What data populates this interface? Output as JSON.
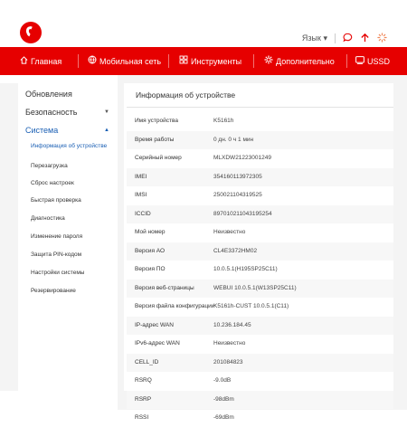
{
  "header": {
    "language_label": "Язык",
    "language_caret": "▾"
  },
  "nav": {
    "items": [
      {
        "label": "Главная",
        "icon": "home-icon"
      },
      {
        "label": "Мобильная сеть",
        "icon": "globe-icon"
      },
      {
        "label": "Инструменты",
        "icon": "tools-icon"
      },
      {
        "label": "Дополнительно",
        "icon": "gear-icon"
      },
      {
        "label": "USSD",
        "icon": "ussd-icon"
      }
    ]
  },
  "sidebar": {
    "sections": [
      {
        "label": "Обновления"
      },
      {
        "label": "Безопасность",
        "caret": "▼"
      },
      {
        "label": "Система",
        "caret": "▲"
      }
    ],
    "subitems": [
      "Информация об устройстве",
      "Перезагрузка",
      "Сброс настроек",
      "Быстрая проверка",
      "Диагностика",
      "Изменение пароля",
      "Защита PIN-кодом",
      "Настройки системы",
      "Резервирование"
    ]
  },
  "panel": {
    "title": "Информация об устройстве",
    "rows": [
      {
        "label": "Имя устройства",
        "value": "K5161h"
      },
      {
        "label": "Время работы",
        "value": "0 дн. 0 ч 1 мин"
      },
      {
        "label": "Серийный номер",
        "value": "MLXDW21223001249"
      },
      {
        "label": "IMEI",
        "value": "354160113972305"
      },
      {
        "label": "IMSI",
        "value": "250021104319525"
      },
      {
        "label": "ICCID",
        "value": "897010211043195254"
      },
      {
        "label": "Мой номер",
        "value": "Неизвестно"
      },
      {
        "label": "Версия АО",
        "value": "CL4E3372HM02"
      },
      {
        "label": "Версия ПО",
        "value": "10.0.5.1(H195SP25C11)"
      },
      {
        "label": "Версия веб-страницы",
        "value": "WEBUI 10.0.5.1(W13SP25C11)"
      },
      {
        "label": "Версия файла конфигурации",
        "value": "K5161h-CUST 10.0.5.1(C11)"
      },
      {
        "label": "IP-адрес WAN",
        "value": "10.236.184.45"
      },
      {
        "label": "IPv6-адрес WAN",
        "value": "Неизвестно"
      },
      {
        "label": "CELL_ID",
        "value": "201084823"
      },
      {
        "label": "RSRQ",
        "value": "-9.0dB"
      },
      {
        "label": "RSRP",
        "value": "-98dBm"
      },
      {
        "label": "RSSI",
        "value": "-69dBm"
      }
    ]
  },
  "colors": {
    "brand": "#e60000",
    "active_link": "#1a5fb4"
  }
}
